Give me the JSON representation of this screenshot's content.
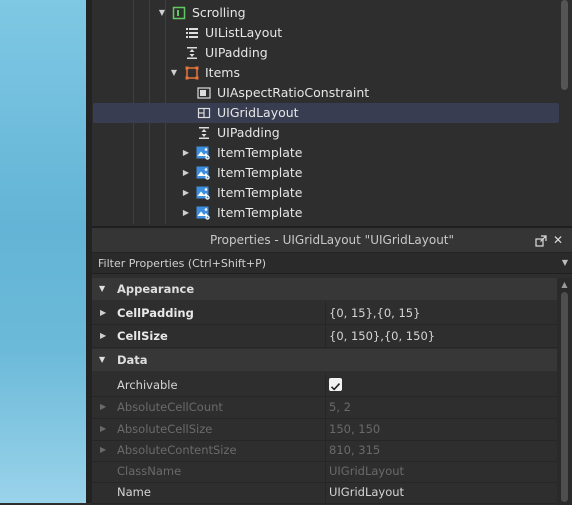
{
  "explorer": {
    "items": [
      {
        "label": "Scrolling",
        "icon": "scrolling-frame-icon",
        "expanded": true
      },
      {
        "label": "UIListLayout",
        "icon": "list-layout-icon"
      },
      {
        "label": "UIPadding",
        "icon": "padding-icon"
      },
      {
        "label": "Items",
        "icon": "frame-icon",
        "expanded": true
      },
      {
        "label": "UIAspectRatioConstraint",
        "icon": "aspect-ratio-icon"
      },
      {
        "label": "UIGridLayout",
        "icon": "grid-layout-icon",
        "selected": true
      },
      {
        "label": "UIPadding",
        "icon": "padding-icon"
      },
      {
        "label": "ItemTemplate",
        "icon": "image-button-icon",
        "expanded": false
      },
      {
        "label": "ItemTemplate",
        "icon": "image-button-icon",
        "expanded": false
      },
      {
        "label": "ItemTemplate",
        "icon": "image-button-icon",
        "expanded": false
      },
      {
        "label": "ItemTemplate",
        "icon": "image-button-icon",
        "expanded": false
      }
    ]
  },
  "properties": {
    "title": "Properties - UIGridLayout \"UIGridLayout\"",
    "filter_placeholder": "Filter Properties (Ctrl+Shift+P)",
    "sections": {
      "appearance": "Appearance",
      "data": "Data"
    },
    "rows": {
      "cellpadding": {
        "name": "CellPadding",
        "value": "{0, 15},{0, 15}"
      },
      "cellsize": {
        "name": "CellSize",
        "value": "{0, 150},{0, 150}"
      },
      "archivable": {
        "name": "Archivable",
        "checked": true
      },
      "absolutecellcount": {
        "name": "AbsoluteCellCount",
        "value": "5, 2"
      },
      "absolutecellsize": {
        "name": "AbsoluteCellSize",
        "value": "150, 150"
      },
      "absolutecontentsize": {
        "name": "AbsoluteContentSize",
        "value": "810, 315"
      },
      "classname": {
        "name": "ClassName",
        "value": "UIGridLayout"
      },
      "name": {
        "name": "Name",
        "value": "UIGridLayout"
      }
    }
  },
  "colors": {
    "selection": "#383d52",
    "panel": "#2e2e2e",
    "accent_orange": "#e8743b",
    "accent_green": "#5fc95f",
    "accent_blue": "#3e8ee0"
  }
}
